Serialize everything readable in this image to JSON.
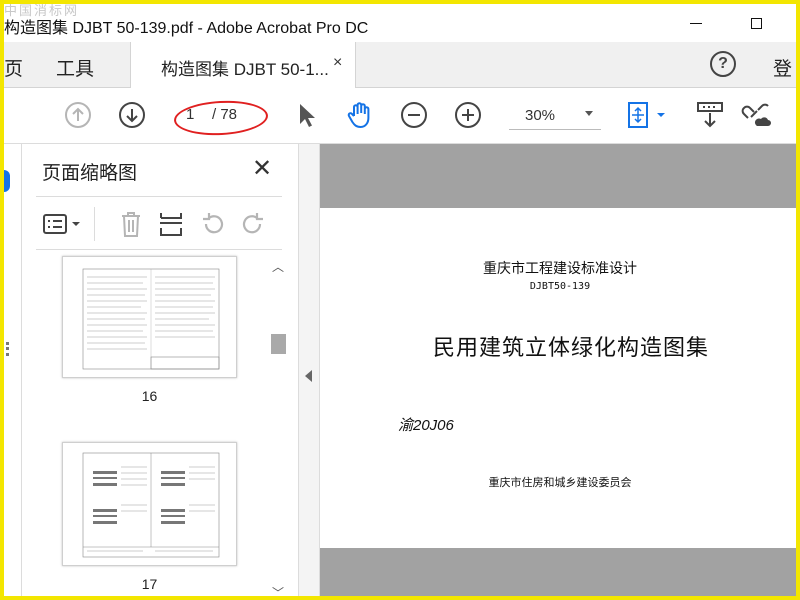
{
  "watermark": "中国消标网",
  "window": {
    "title": "构造图集 DJBT 50-139.pdf - Adobe Acrobat Pro DC"
  },
  "tabs": {
    "home": "页",
    "tools": "工具",
    "document": "构造图集 DJBT 50-1...",
    "close_symbol": "×",
    "signin": "登",
    "help_symbol": "?"
  },
  "toolbar": {
    "page_current": "1",
    "page_total": "/ 78",
    "zoom": "30%"
  },
  "panel": {
    "title": "页面缩略图",
    "close_symbol": "✕",
    "thumbnails": [
      {
        "page": "16"
      },
      {
        "page": "17"
      }
    ]
  },
  "document": {
    "line1": "重庆市工程建设标准设计",
    "line2": "DJBT50-139",
    "main_title": "民用建筑立体绿化构造图集",
    "code": "渝20J06",
    "issuer": "重庆市住房和城乡建设委员会"
  },
  "colors": {
    "accent_blue": "#1473e6",
    "annotation_red": "#e02020",
    "frame_yellow": "#f3e600",
    "canvas_gray": "#a2a2a2"
  },
  "icons": {
    "prev_page": "arrow-up-circle-icon",
    "next_page": "arrow-down-circle-icon",
    "select": "cursor-arrow-icon",
    "hand": "hand-tool-icon",
    "zoom_out": "zoom-out-icon",
    "zoom_in": "zoom-in-icon",
    "fit": "page-fit-icon",
    "scroll": "scroll-mode-icon",
    "share": "share-link-icon"
  }
}
